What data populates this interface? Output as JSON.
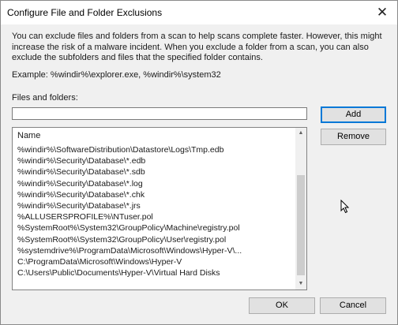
{
  "window": {
    "title": "Configure File and Folder Exclusions",
    "close_glyph": "✕"
  },
  "description": "You can exclude files and folders from a scan to help scans complete faster. However, this might increase the risk of a malware incident. When you exclude a folder from a scan, you can also exclude the subfolders and files that the specified folder contains.",
  "example": "Example: %windir%\\explorer.exe, %windir%\\system32",
  "files_label": "Files and folders:",
  "input": {
    "value": "",
    "placeholder": ""
  },
  "buttons": {
    "add": "Add",
    "remove": "Remove",
    "ok": "OK",
    "cancel": "Cancel"
  },
  "list": {
    "header": "Name",
    "items": [
      "%windir%\\SoftwareDistribution\\Datastore\\Logs\\Tmp.edb",
      "%windir%\\Security\\Database\\*.edb",
      "%windir%\\Security\\Database\\*.sdb",
      "%windir%\\Security\\Database\\*.log",
      "%windir%\\Security\\Database\\*.chk",
      "%windir%\\Security\\Database\\*.jrs",
      "%ALLUSERSPROFILE%\\NTuser.pol",
      "%SystemRoot%\\System32\\GroupPolicy\\Machine\\registry.pol",
      "%SystemRoot%\\System32\\GroupPolicy\\User\\registry.pol",
      "%systemdrive%\\ProgramData\\Microsoft\\Windows\\Hyper-V\\...",
      "C:\\ProgramData\\Microsoft\\Windows\\Hyper-V",
      "C:\\Users\\Public\\Documents\\Hyper-V\\Virtual Hard Disks"
    ]
  },
  "scrollbar": {
    "up_glyph": "▲",
    "down_glyph": "▼"
  },
  "colors": {
    "default_button_border": "#0078d7",
    "background": "#f0f0f0"
  }
}
